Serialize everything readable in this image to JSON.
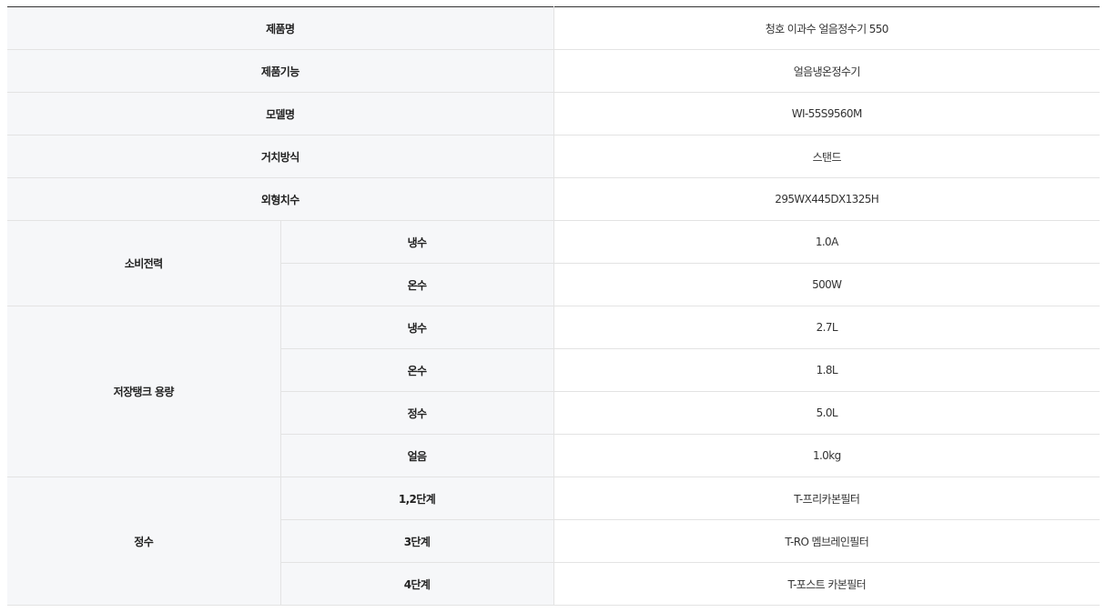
{
  "spec_table": {
    "rows_simple": [
      {
        "label": "제품명",
        "value": "청호 이과수 얼음정수기 550"
      },
      {
        "label": "제품기능",
        "value": "얼음냉온정수기"
      },
      {
        "label": "모델명",
        "value": "WI-55S9560M"
      },
      {
        "label": "거치방식",
        "value": "스탠드"
      },
      {
        "label": "외형치수",
        "value": "295WX445DX1325H"
      }
    ],
    "power": {
      "label": "소비전력",
      "rows": [
        {
          "sub": "냉수",
          "value": "1.0A"
        },
        {
          "sub": "온수",
          "value": "500W"
        }
      ]
    },
    "tank": {
      "label": "저장탱크 용량",
      "rows": [
        {
          "sub": "냉수",
          "value": "2.7L"
        },
        {
          "sub": "온수",
          "value": "1.8L"
        },
        {
          "sub": "정수",
          "value": "5.0L"
        },
        {
          "sub": "얼음",
          "value": "1.0kg"
        }
      ]
    },
    "filter": {
      "label": "정수",
      "rows": [
        {
          "sub": "1,2단계",
          "value": "T-프리카본필터"
        },
        {
          "sub": "3단계",
          "value": "T-RO 멤브레인필터"
        },
        {
          "sub": "4단계",
          "value": "T-포스트 카본필터"
        }
      ]
    }
  }
}
